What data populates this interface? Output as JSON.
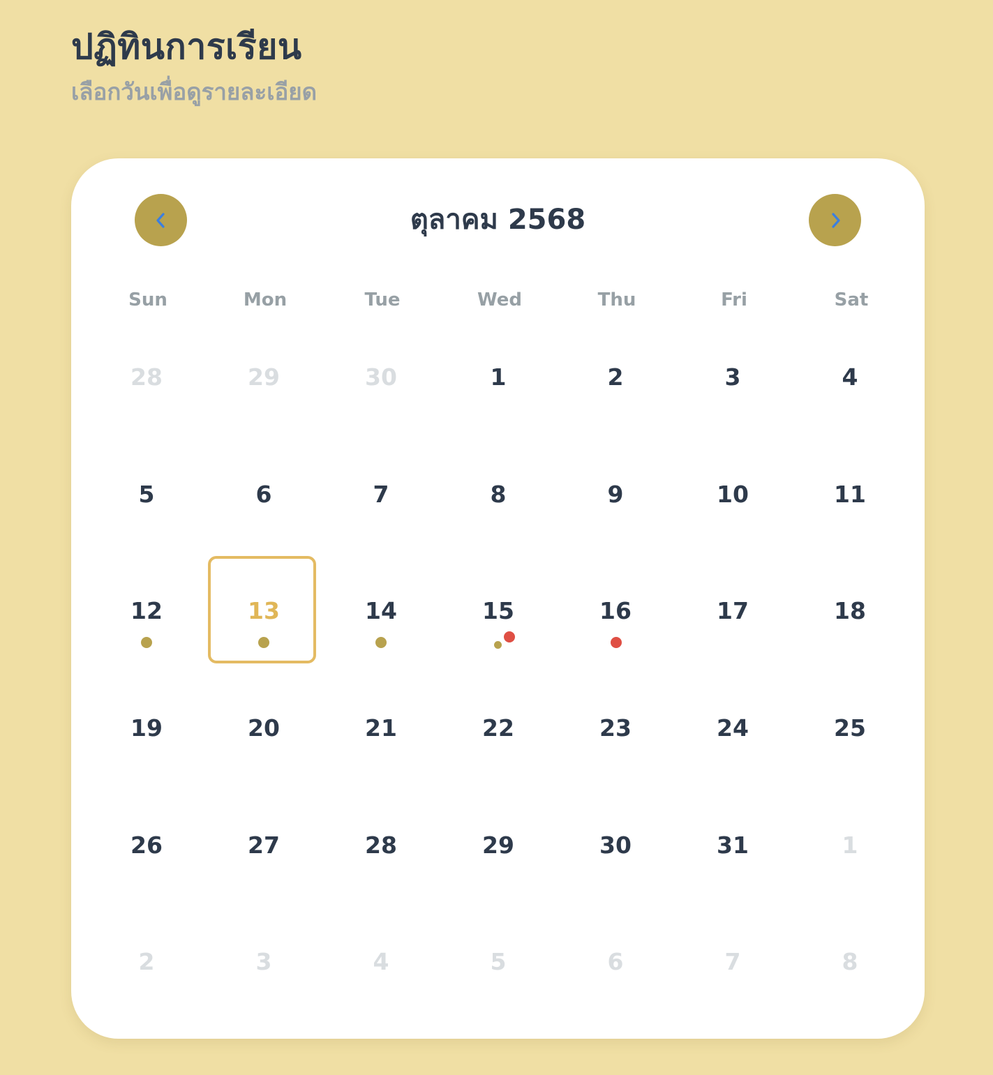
{
  "header": {
    "title": "ปฏิทินการเรียน",
    "subtitle": "เลือกวันเพื่อดูรายละเอียด"
  },
  "calendar": {
    "month_label": "ตุลาคม 2568",
    "prev_icon": "chevron-left-icon",
    "next_icon": "chevron-right-icon",
    "weekdays": [
      "Sun",
      "Mon",
      "Tue",
      "Wed",
      "Thu",
      "Fri",
      "Sat"
    ],
    "days": [
      {
        "label": "28",
        "outside": true
      },
      {
        "label": "29",
        "outside": true
      },
      {
        "label": "30",
        "outside": true
      },
      {
        "label": "1"
      },
      {
        "label": "2"
      },
      {
        "label": "3"
      },
      {
        "label": "4"
      },
      {
        "label": "5"
      },
      {
        "label": "6"
      },
      {
        "label": "7"
      },
      {
        "label": "8"
      },
      {
        "label": "9"
      },
      {
        "label": "10"
      },
      {
        "label": "11"
      },
      {
        "label": "12",
        "dots": [
          "gold"
        ]
      },
      {
        "label": "13",
        "selected": true,
        "dots": [
          "gold"
        ]
      },
      {
        "label": "14",
        "dots": [
          "gold"
        ]
      },
      {
        "label": "15",
        "dots": [
          "gold-small",
          "red-offset"
        ]
      },
      {
        "label": "16",
        "dots": [
          "red"
        ]
      },
      {
        "label": "17"
      },
      {
        "label": "18"
      },
      {
        "label": "19"
      },
      {
        "label": "20"
      },
      {
        "label": "21"
      },
      {
        "label": "22"
      },
      {
        "label": "23"
      },
      {
        "label": "24"
      },
      {
        "label": "25"
      },
      {
        "label": "26"
      },
      {
        "label": "27"
      },
      {
        "label": "28"
      },
      {
        "label": "29"
      },
      {
        "label": "30"
      },
      {
        "label": "31"
      },
      {
        "label": "1",
        "outside": true
      },
      {
        "label": "2",
        "outside": true
      },
      {
        "label": "3",
        "outside": true
      },
      {
        "label": "4",
        "outside": true
      },
      {
        "label": "5",
        "outside": true
      },
      {
        "label": "6",
        "outside": true
      },
      {
        "label": "7",
        "outside": true
      },
      {
        "label": "8",
        "outside": true
      }
    ]
  },
  "colors": {
    "background": "#f0dfa4",
    "card": "#ffffff",
    "accent": "#b8a24e",
    "selected": "#e0b657",
    "event_red": "#df4f44",
    "text": "#2e3a4b",
    "muted": "#97a0a5",
    "outside_day": "#d9dde0"
  }
}
